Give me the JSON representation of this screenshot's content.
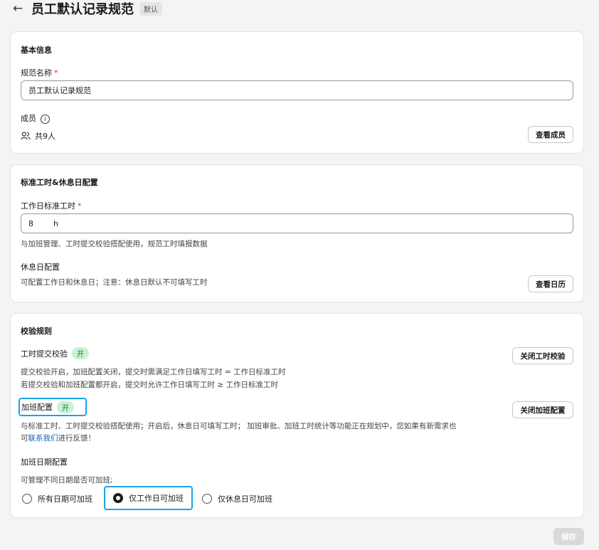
{
  "header": {
    "title": "员工默认记录规范",
    "tag": "默认"
  },
  "basic": {
    "section_title": "基本信息",
    "name_label": "规范名称",
    "required_mark": "*",
    "name_value": "员工默认记录规范",
    "members_label": "成员",
    "info_glyph": "i",
    "members_count": "共9人",
    "view_members_button": "查看成员"
  },
  "standard": {
    "section_title": "标准工时&休息日配置",
    "hours_label": "工作日标准工时",
    "required_mark": "*",
    "hours_value": "8",
    "hours_unit": "h",
    "hours_hint": "与加班管理、工时提交校验搭配使用，规范工时填报数据",
    "rest_label": "休息日配置",
    "rest_hint": "可配置工作日和休息日；注意：休息日默认不可填写工时",
    "view_calendar_button": "查看日历"
  },
  "rules": {
    "section_title": "校验规则",
    "submit_check_label": "工时提交校验",
    "submit_check_state": "开",
    "close_submit_check_button": "关闭工时校验",
    "submit_desc_1": "提交校验开启，加班配置关闭，提交时需满足工作日填写工时 = 工作日标准工时",
    "submit_desc_2": "若提交校验和加班配置都开启，提交时允许工作日填写工时 ≥ 工作日标准工时",
    "overtime_label": "加班配置",
    "overtime_state": "开",
    "close_overtime_button": "关闭加班配置",
    "overtime_desc_1": "与标准工时、工时提交校验搭配使用；开启后，休息日可填写工时； 加班审批、加班工时统计等功能正在规划中，您如果有新需求也",
    "overtime_desc_2_prefix": "可",
    "overtime_desc_2_link": "联系我们",
    "overtime_desc_2_suffix": "进行反馈！",
    "date_config_label": "加班日期配置",
    "date_config_hint": "可管理不同日期是否可加班;",
    "options": [
      "所有日期可加班",
      "仅工作日可加班",
      "仅休息日可加班"
    ],
    "selected_option": "仅工作日可加班"
  },
  "footer": {
    "save_button": "保存"
  }
}
